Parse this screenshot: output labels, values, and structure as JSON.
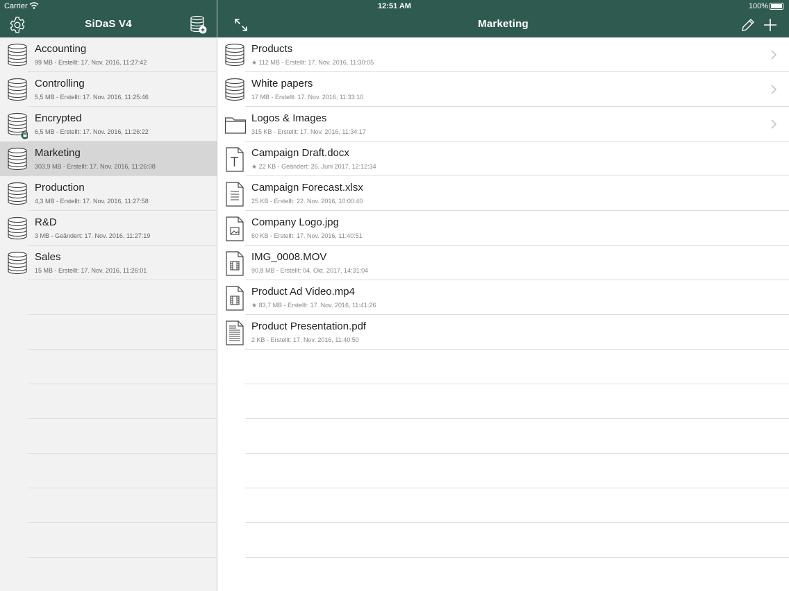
{
  "status_bar": {
    "carrier": "Carrier",
    "time": "12:51 AM",
    "battery": "100%"
  },
  "left_nav": {
    "title": "SiDaS V4",
    "settings_icon": "gear-icon",
    "add_db_icon": "database-add-icon"
  },
  "databases": [
    {
      "name": "Accounting",
      "meta": "99 MB - Erstellt: 17. Nov. 2016, 11:27:42",
      "icon": "database-icon"
    },
    {
      "name": "Controlling",
      "meta": "5,5 MB - Erstellt: 17. Nov. 2016, 11:25:46",
      "icon": "database-icon"
    },
    {
      "name": "Encrypted",
      "meta": "6,5 MB - Erstellt: 17. Nov. 2016, 11:26:22",
      "icon": "database-lock-icon"
    },
    {
      "name": "Marketing",
      "meta": "303,9 MB - Erstellt: 17. Nov. 2016, 11:26:08",
      "icon": "database-icon",
      "selected": true
    },
    {
      "name": "Production",
      "meta": "4,3 MB - Erstellt: 17. Nov. 2016, 11:27:58",
      "icon": "database-icon"
    },
    {
      "name": "R&D",
      "meta": "3 MB - Geändert: 17. Nov. 2016, 11:27:19",
      "icon": "database-icon"
    },
    {
      "name": "Sales",
      "meta": "15 MB - Erstellt: 17. Nov. 2016, 11:26:01",
      "icon": "database-icon"
    }
  ],
  "right_nav": {
    "title": "Marketing",
    "expand_icon": "expand-icon",
    "edit_icon": "pencil-icon",
    "add_icon": "plus-icon"
  },
  "items": [
    {
      "name": "Products",
      "meta": "★ 112 MB - Erstellt: 17. Nov. 2016, 11:30:05",
      "icon": "database-icon",
      "chevron": true
    },
    {
      "name": "White papers",
      "meta": "17 MB - Erstellt: 17. Nov. 2016, 11:33:10",
      "icon": "database-icon",
      "chevron": true
    },
    {
      "name": "Logos & Images",
      "meta": "315 KB - Erstellt: 17. Nov. 2016, 11:34:17",
      "icon": "folder-icon",
      "chevron": true
    },
    {
      "name": "Campaign Draft.docx",
      "meta": "★ 22 KB - Geändert: 26. Juni 2017, 12:12:34",
      "icon": "text-document-icon"
    },
    {
      "name": "Campaign Forecast.xlsx",
      "meta": "25 KB - Erstellt: 22. Nov. 2016, 10:00:40",
      "icon": "spreadsheet-document-icon"
    },
    {
      "name": "Company Logo.jpg",
      "meta": "60 KB - Erstellt: 17. Nov. 2016, 11:40:51",
      "icon": "image-document-icon"
    },
    {
      "name": "IMG_0008.MOV",
      "meta": "90,8 MB - Erstellt: 04. Okt. 2017, 14:31:04",
      "icon": "video-document-icon"
    },
    {
      "name": "Product Ad Video.mp4",
      "meta": "★ 83,7 MB - Erstellt: 17. Nov. 2016, 11:41:26",
      "icon": "video-document-icon"
    },
    {
      "name": "Product Presentation.pdf",
      "meta": "2 KB - Erstellt: 17. Nov. 2016, 11:40:50",
      "icon": "pdf-document-icon"
    }
  ],
  "colors": {
    "nav_bg": "#2e5a4f",
    "selected_row": "#d6d6d6",
    "sidebar_bg": "#f2f2f2"
  }
}
